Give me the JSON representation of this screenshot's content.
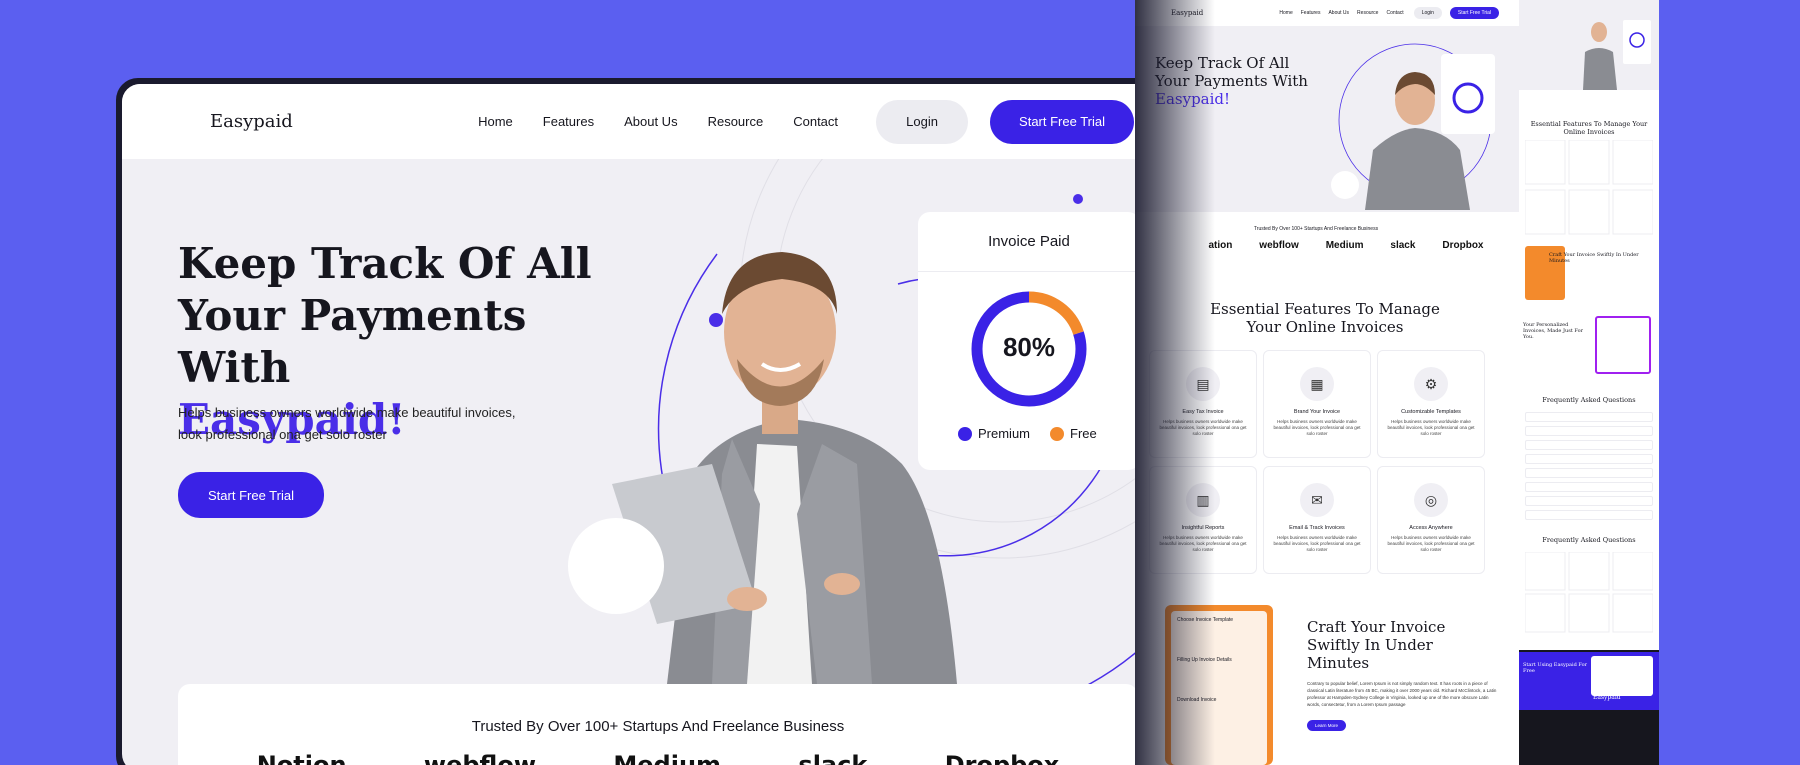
{
  "brand": {
    "name": "Easypaid",
    "accent": "#3a22e6",
    "orange": "#f38a2c",
    "background": "#5b5ff0"
  },
  "nav": {
    "links": [
      "Home",
      "Features",
      "About Us",
      "Resource",
      "Contact"
    ],
    "login": "Login",
    "cta": "Start Free Trial"
  },
  "hero": {
    "title_line1": "Keep Track Of All",
    "title_line2": "Your Payments With",
    "title_accent": "Easypaid!",
    "subtitle": "Helps business owners worldwide make beautiful invoices, look professional ona get solo roster",
    "cta": "Start Free Trial"
  },
  "invoice_card": {
    "title": "Invoice Paid",
    "percent_label": "80%",
    "percent": 0.8,
    "legend": [
      "Premium",
      "Free"
    ]
  },
  "trusted": {
    "title": "Trusted By Over 100+ Startups And Freelance Business",
    "logos": [
      "Notion",
      "webflow",
      "Medium",
      "slack",
      "Dropbox"
    ]
  },
  "page2": {
    "nav_links": [
      "Home",
      "Features",
      "About Us",
      "Resource",
      "Contact"
    ],
    "login": "Login",
    "cta": "Start Free Trial",
    "hero_line1": "Keep Track Of All",
    "hero_line2": "Your Payments With",
    "hero_accent": "Easypaid!",
    "trusted_title": "Trusted By Over 100+ Startups And Freelance Business",
    "logos": [
      "ation",
      "webflow",
      "Medium",
      "slack",
      "Dropbox"
    ],
    "features_title": "Essential Features To Manage Your Online Invoices",
    "features": [
      {
        "title": "Easy Tax Invoice",
        "icon": "document-icon"
      },
      {
        "title": "Brand Your Invoice",
        "icon": "invoice-icon"
      },
      {
        "title": "Customizable Templates",
        "icon": "gear-icon"
      },
      {
        "title": "Insightful Reports",
        "icon": "chart-icon"
      },
      {
        "title": "Email & Track Invoices",
        "icon": "mail-icon"
      },
      {
        "title": "Access Anywhere",
        "icon": "globe-icon"
      }
    ],
    "feature_desc": "Helps business owners worldwide make beautiful invoices, look professional ona get solo roster",
    "craft_steps": [
      "Choose Invoice Template",
      "Filling Up Invoice Details",
      "Download Invoice"
    ],
    "craft_title": "Craft Your Invoice Swiftly In Under Minutes",
    "craft_desc": "Contrary to popular belief, Lorem Ipsum is not simply random text. It has roots in a piece of classical Latin literature from 45 BC, making it over 2000 years old. Richard McClintock, a Latin professor at Hampden-Sydney College in Virginia, looked up one of the more obscure Latin words, consectetur, from a Lorem Ipsum passage",
    "craft_btn": "Learn More"
  },
  "page3": {
    "features_title": "Essential Features To Manage Your Online Invoices",
    "craft_title": "Craft Your Invoice Swiftly In Under Minutes",
    "personalized_title": "Your Personalized Invoices, Made Just For You.",
    "faq_title": "Frequently Asked Questions",
    "faq_title2": "Frequently Asked Questions",
    "cta_title": "Start Using Easypaid For Free",
    "footer_brand": "Easypaid"
  }
}
